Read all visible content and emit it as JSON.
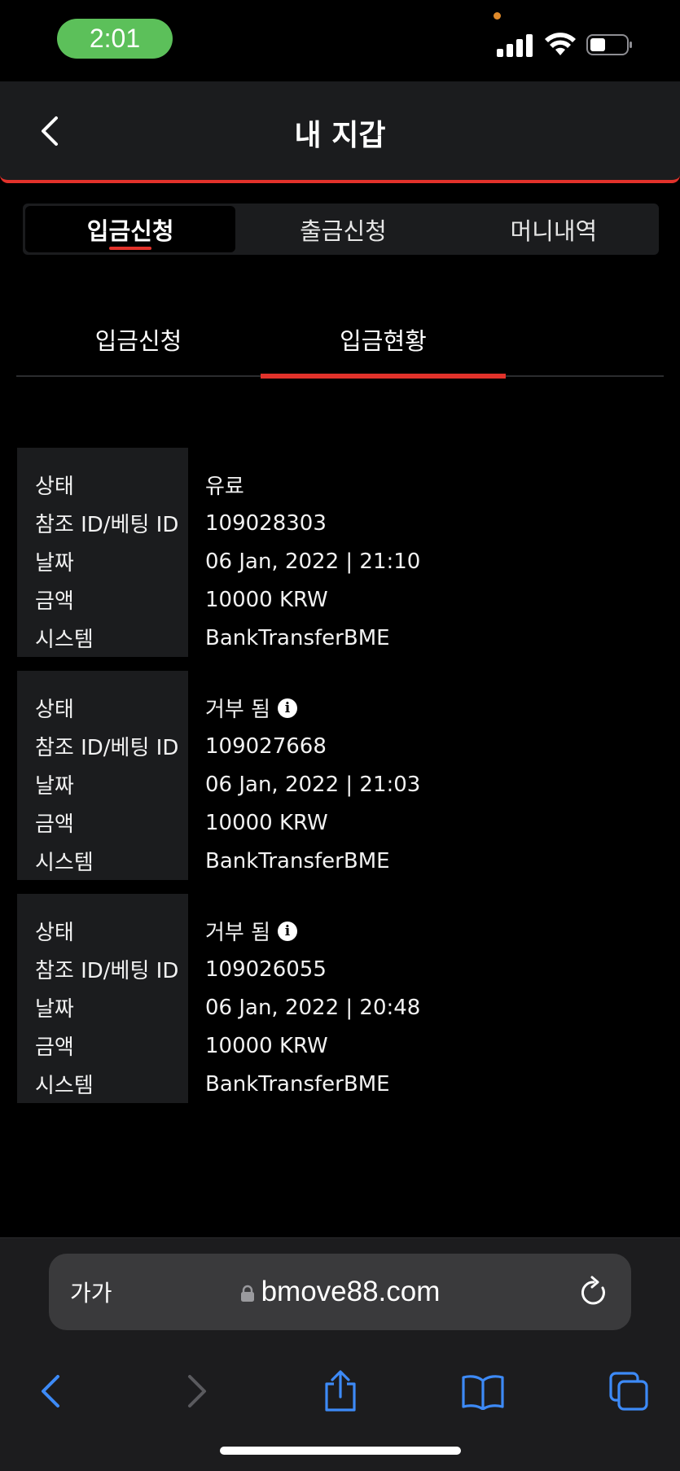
{
  "status_bar": {
    "time": "2:01"
  },
  "header": {
    "title": "내 지갑"
  },
  "segment_tabs": [
    {
      "label": "입금신청",
      "active": true
    },
    {
      "label": "출금신청",
      "active": false
    },
    {
      "label": "머니내역",
      "active": false
    }
  ],
  "sub_tabs": [
    {
      "label": "입금신청",
      "active": false
    },
    {
      "label": "입금현황",
      "active": true
    }
  ],
  "records": [
    {
      "status_label": "상태",
      "status": "유료",
      "ref_label": "참조 ID/베팅 ID",
      "ref": "109028303",
      "date_label": "날짜",
      "date": "06 Jan, 2022 | 21:10",
      "amount_label": "금액",
      "amount": "10000 KRW",
      "system_label": "시스템",
      "system": "BankTransferBME"
    },
    {
      "status_label": "상태",
      "status": "거부 됨",
      "ref_label": "참조 ID/베팅 ID",
      "ref": "109027668",
      "date_label": "날짜",
      "date": "06 Jan, 2022 | 21:03",
      "amount_label": "금액",
      "amount": "10000 KRW",
      "system_label": "시스템",
      "system": "BankTransferBME"
    },
    {
      "status_label": "상태",
      "status": "거부 됨",
      "ref_label": "참조 ID/베팅 ID",
      "ref": "109026055",
      "date_label": "날짜",
      "date": "06 Jan, 2022 | 20:48",
      "amount_label": "금액",
      "amount": "10000 KRW",
      "system_label": "시스템",
      "system": "BankTransferBME"
    }
  ],
  "browser": {
    "text_size_label": "가가",
    "url": "bmove88.com"
  },
  "colors": {
    "accent": "#e2322b",
    "panel": "#1b1c1e",
    "time_pill": "#5cc05a",
    "ios_blue": "#3d8af7"
  },
  "icons": {
    "back": "chevron-left-icon",
    "info": "info-icon",
    "lock": "lock-icon",
    "reload": "reload-icon",
    "share": "share-icon",
    "bookmarks": "book-icon",
    "tabs": "tabs-icon"
  }
}
